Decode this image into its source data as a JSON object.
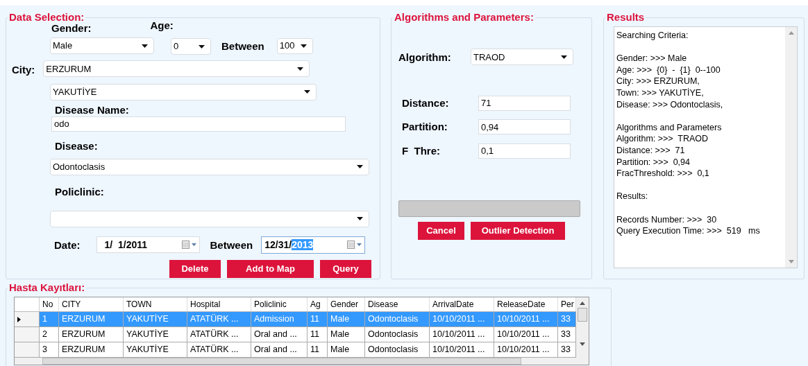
{
  "data_selection": {
    "title": "Data Selection:",
    "gender": {
      "label": "Gender:",
      "value": "Male"
    },
    "age": {
      "label": "Age:",
      "from": "0",
      "between_label": "Between",
      "to": "100"
    },
    "city": {
      "label": "City:",
      "value": "ERZURUM",
      "town": "YAKUTİYE"
    },
    "disease_name": {
      "label": "Disease Name:",
      "value": "odo"
    },
    "disease": {
      "label": "Disease:",
      "value": "Odontoclasis"
    },
    "policlinic": {
      "label": "Policlinic:"
    },
    "date": {
      "label": "Date:",
      "from": "1/  1/2011",
      "between_label": "Between",
      "to_prefix": "12/31/",
      "to_selected": "2013"
    },
    "buttons": [
      "Delete",
      "Add to Map",
      "Query"
    ]
  },
  "algorithms": {
    "title": "Algorithms and Parameters:",
    "algorithm": {
      "label": "Algorithm:",
      "value": "TRAOD"
    },
    "params": [
      {
        "label": "Distance:",
        "value": "71"
      },
      {
        "label": "Partition:",
        "value": "0,94"
      },
      {
        "label": "F  Thre:",
        "value": "0,1"
      }
    ],
    "progress": {
      "level": 0
    },
    "buttons": [
      "Cancel",
      "Outlier Detection"
    ]
  },
  "results": {
    "title": "Results",
    "paragraphs": [
      [
        "Searching Criteria:"
      ],
      [
        "Gender: >>> Male",
        "Age: >>>  {0}  -  {1}  0--100",
        "City: >>> ERZURUM,",
        "Town: >>> YAKUTİYE,",
        "Disease: >>> Odontoclasis,"
      ],
      [
        "Algorithms and Parameters",
        "Algorithm: >>>  TRAOD",
        "Distance: >>>  71",
        "Partition: >>>  0,94",
        "FracThreshold: >>>  0,1"
      ],
      [
        "Results:"
      ],
      [
        "Records Number: >>>  30",
        "Query Execution Time: >>>  519   ms"
      ]
    ]
  },
  "records": {
    "title": "Hasta Kayıtları:",
    "columns": [
      "No",
      "CITY",
      "TOWN",
      "Hospital",
      "Policlinic",
      "Ag",
      "Gender",
      "Disease",
      "ArrivalDate",
      "ReleaseDate",
      "Per"
    ],
    "rows": [
      {
        "selected": true,
        "cells": [
          "1",
          "ERZURUM",
          "YAKUTİYE",
          "ATATÜRK ...",
          "Admission",
          "11",
          "Male",
          "Odontoclasis",
          "10/10/2011 ...",
          "10/10/2011 ...",
          "33"
        ]
      },
      {
        "selected": false,
        "cells": [
          "2",
          "ERZURUM",
          "YAKUTİYE",
          "ATATÜRK ...",
          "Oral and ...",
          "11",
          "Male",
          "Odontoclasis",
          "10/10/2011 ...",
          "10/10/2011 ...",
          "33"
        ]
      },
      {
        "selected": false,
        "cells": [
          "3",
          "ERZURUM",
          "YAKUTİYE",
          "ATATÜRK ...",
          "Oral and ...",
          "11",
          "Male",
          "Odontoclasis",
          "10/10/2011 ...",
          "10/10/2011 ...",
          "33"
        ]
      }
    ]
  }
}
